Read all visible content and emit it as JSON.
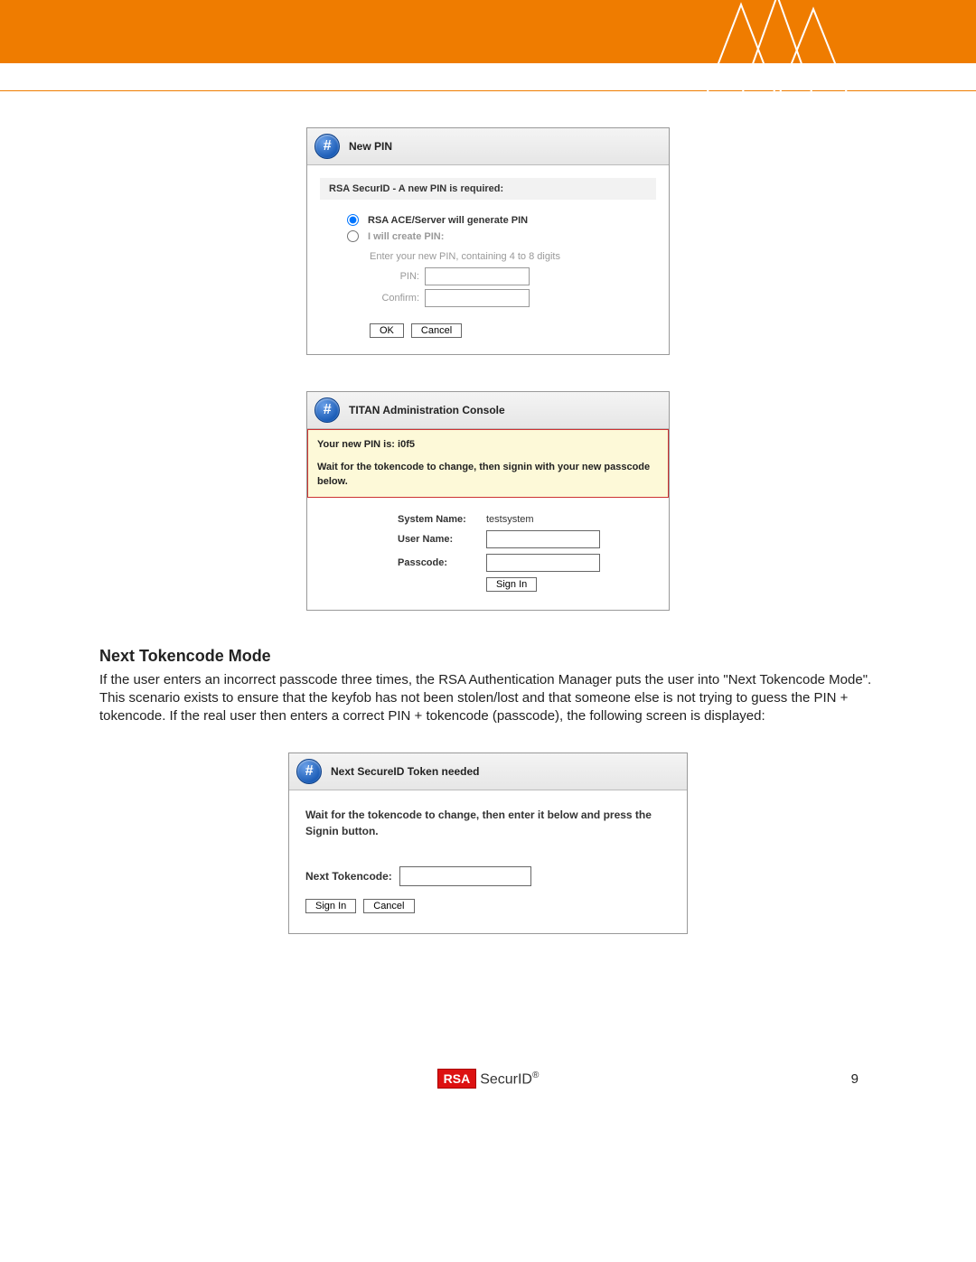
{
  "panel1": {
    "title": "New PIN",
    "subheading": "RSA SecurID - A new PIN is required:",
    "radio1_label": "RSA ACE/Server will generate PIN",
    "radio2_label": "I will create PIN:",
    "hint": "Enter your new PIN, containing 4 to 8 digits",
    "pin_label": "PIN:",
    "confirm_label": "Confirm:",
    "ok_button": "OK",
    "cancel_button": "Cancel"
  },
  "panel2": {
    "title": "TITAN Administration Console",
    "notice_line1": "Your new PIN is: i0f5",
    "notice_line2": "Wait for the tokencode to change, then signin with your new passcode below.",
    "system_name_label": "System Name:",
    "system_name_value": "testsystem",
    "user_name_label": "User Name:",
    "passcode_label": "Passcode:",
    "signin_button": "Sign In"
  },
  "section": {
    "title": "Next Tokencode Mode",
    "body": "If the user enters an incorrect passcode three times, the RSA Authentication Manager puts the user into \"Next Tokencode Mode\". This scenario exists to ensure that the keyfob has not been stolen/lost and that someone else is not trying to guess the PIN + tokencode. If the real user then enters a correct PIN + tokencode (passcode), the following screen is displayed:"
  },
  "panel3": {
    "title": "Next SecureID Token needed",
    "instruction": "Wait for the tokencode to change, then enter it below and press the Signin button.",
    "tokencode_label": "Next Tokencode:",
    "signin_button": "Sign In",
    "cancel_button": "Cancel"
  },
  "footer": {
    "brand_box": "RSA",
    "brand_text": "SecurID",
    "page_number": "9"
  }
}
